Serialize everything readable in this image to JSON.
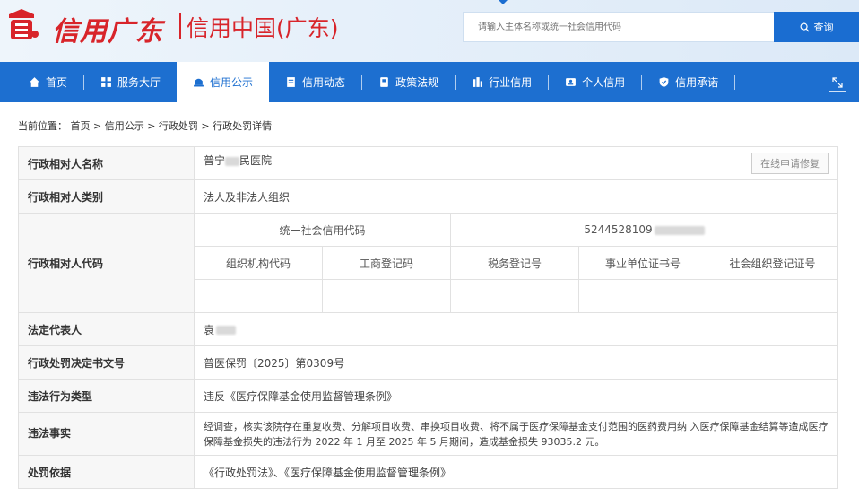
{
  "header": {
    "logo_text": "信用广东",
    "logo_sub": "信用中国(广东)",
    "search_placeholder": "请输入主体名称或统一社会信用代码",
    "search_button": "查询",
    "brand_red": "#d8242a",
    "brand_blue": "#1d6fd0"
  },
  "nav": {
    "items": [
      {
        "label": "首页",
        "icon": "home-icon"
      },
      {
        "label": "服务大厅",
        "icon": "grid-icon"
      },
      {
        "label": "信用公示",
        "icon": "bell-icon",
        "active": true
      },
      {
        "label": "信用动态",
        "icon": "document-icon"
      },
      {
        "label": "政策法规",
        "icon": "book-icon"
      },
      {
        "label": "行业信用",
        "icon": "building-icon"
      },
      {
        "label": "个人信用",
        "icon": "id-card-icon"
      },
      {
        "label": "信用承诺",
        "icon": "shield-icon"
      }
    ]
  },
  "breadcrumb": {
    "prefix": "当前位置：",
    "path": "首页 > 信用公示 > 行政处罚 > 行政处罚详情"
  },
  "detail": {
    "subject_name_label": "行政相对人名称",
    "subject_name_prefix": "普宁",
    "subject_name_suffix": "民医院",
    "repair_button": "在线申请修复",
    "subject_type_label": "行政相对人类别",
    "subject_type": "法人及非法人组织",
    "subject_code_label": "行政相对人代码",
    "uscc_label": "统一社会信用代码",
    "uscc_value": "5244528109",
    "code_headers": [
      "组织机构代码",
      "工商登记码",
      "税务登记号",
      "事业单位证书号",
      "社会组织登记证号"
    ],
    "legal_rep_label": "法定代表人",
    "legal_rep_value": "袁",
    "decision_no_label": "行政处罚决定书文号",
    "decision_no_value": "普医保罚〔2025〕第0309号",
    "violation_type_label": "违法行为类型",
    "violation_type_value": "违反《医疗保障基金使用监督管理条例》",
    "facts_label": "违法事实",
    "facts_value": "经调查，核实该院存在重复收费、分解项目收费、串换项目收费、将不属于医疗保障基金支付范围的医药费用纳 入医疗保障基金结算等造成医疗保障基金损失的违法行为 2022 年 1 月至 2025 年 5 月期间，造成基金损失 93035.2 元。",
    "basis_label": "处罚依据",
    "basis_value": "《行政处罚法》、《医疗保障基金使用监督管理条例》"
  }
}
